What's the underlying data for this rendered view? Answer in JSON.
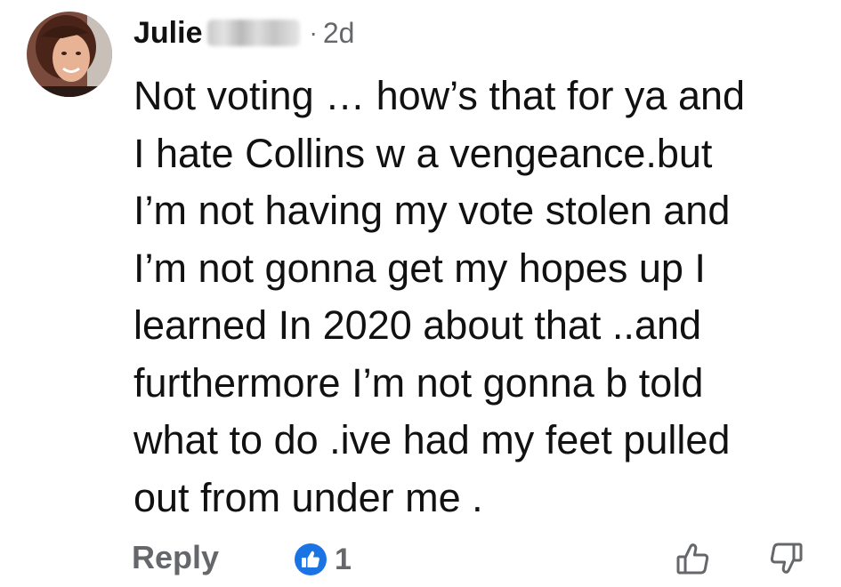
{
  "comment": {
    "author_name": "Julie",
    "separator": "·",
    "timestamp": "2d",
    "body_lines": [
      "Not voting … how’s that for ya and",
      "I hate Collins w a vengeance.but",
      "I’m not having my vote stolen and",
      "I’m not gonna get my hopes up I",
      "learned In 2020 about that ..and",
      "furthermore I’m not gonna b told",
      "what to do .ive had my feet pulled",
      "out from under me ."
    ],
    "reply_label": "Reply",
    "reaction_count": "1",
    "reaction_type": "like-icon",
    "upvote_icon": "thumbs-up-outline-icon",
    "downvote_icon": "thumbs-down-outline-icon"
  },
  "colors": {
    "text": "#111111",
    "muted": "#65676b",
    "like_blue": "#1b74e4",
    "background": "#ffffff"
  }
}
